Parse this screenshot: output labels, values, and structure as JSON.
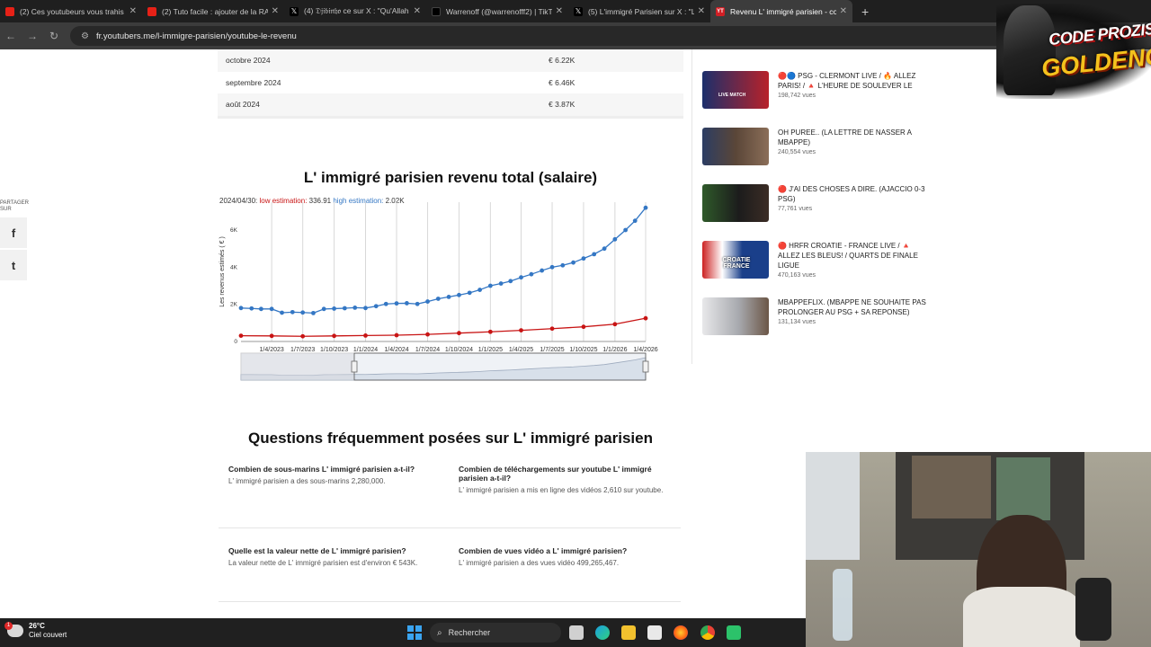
{
  "browser": {
    "tabs": [
      {
        "title": "(2) Ces youtubeurs vous trahis",
        "favicon": "youtube-icon"
      },
      {
        "title": "(2) Tuto facile : ajouter de la RA",
        "favicon": "youtube-icon"
      },
      {
        "title": "(4) 𝔇𝔧𝔦𝔟𝔦𝔫𝔥𝔬 ce sur X : \"Qu'Allah",
        "favicon": "x-icon"
      },
      {
        "title": "Warrenoff (@warrenofff2) | TikT",
        "favicon": "tiktok-icon"
      },
      {
        "title": "(5) L'immigré Parisien sur X : \"L",
        "favicon": "x-icon"
      },
      {
        "title": "Revenu L' immigré parisien - co",
        "favicon": "youtubers-icon",
        "active": true
      }
    ],
    "new_tab": "+",
    "url": "fr.youtubers.me/l-immigre-parisien/youtube-le-revenu"
  },
  "earnings_table": {
    "rows": [
      {
        "month": "octobre 2024",
        "value": "€ 6.22K"
      },
      {
        "month": "septembre 2024",
        "value": "€ 6.46K"
      },
      {
        "month": "août 2024",
        "value": "€ 3.87K"
      }
    ]
  },
  "share": {
    "label_line1": "PARTAGER",
    "label_line2": "SUR",
    "facebook": "f",
    "twitter": "t"
  },
  "chart": {
    "title": "L' immigré parisien revenu total (salaire)",
    "info_date": "2024/04/30:",
    "low_label": "low estimation:",
    "low_value": "336.91",
    "high_label": "high estimation:",
    "high_value": "2.02K"
  },
  "chart_data": {
    "type": "line",
    "title": "L' immigré parisien revenu total (salaire)",
    "xlabel": "",
    "ylabel": "Les revenus estimés ( € )",
    "ylim": [
      0,
      7500
    ],
    "y_ticks": [
      "0",
      "2K",
      "4K",
      "6K"
    ],
    "x_ticks": [
      "1/4/2023",
      "1/7/2023",
      "1/10/2023",
      "1/1/2024",
      "1/4/2024",
      "1/7/2024",
      "1/10/2024",
      "1/1/2025",
      "1/4/2025",
      "1/7/2025",
      "1/10/2025",
      "1/1/2026",
      "1/4/2026"
    ],
    "legend": "none",
    "grid": true,
    "series": [
      {
        "name": "high estimation",
        "color": "#3477c4",
        "x": [
          "2023-01-01",
          "2023-02-01",
          "2023-03-01",
          "2023-04-01",
          "2023-05-01",
          "2023-06-01",
          "2023-07-01",
          "2023-08-01",
          "2023-09-01",
          "2023-10-01",
          "2023-11-01",
          "2023-12-01",
          "2024-01-01",
          "2024-02-01",
          "2024-03-01",
          "2024-04-01",
          "2024-05-01",
          "2024-06-01",
          "2024-07-01",
          "2024-08-01",
          "2024-09-01",
          "2024-10-01",
          "2024-11-01",
          "2024-12-01",
          "2025-01-01",
          "2025-02-01",
          "2025-03-01",
          "2025-04-01",
          "2025-05-01",
          "2025-06-01",
          "2025-07-01",
          "2025-08-01",
          "2025-09-01",
          "2025-10-01",
          "2025-11-01",
          "2025-12-01",
          "2026-01-01",
          "2026-02-01",
          "2026-03-01",
          "2026-04-01"
        ],
        "values": [
          1800,
          1780,
          1750,
          1750,
          1550,
          1580,
          1560,
          1530,
          1750,
          1770,
          1790,
          1820,
          1800,
          1900,
          2020,
          2050,
          2060,
          2020,
          2150,
          2300,
          2400,
          2500,
          2620,
          2780,
          3000,
          3120,
          3250,
          3450,
          3620,
          3820,
          4000,
          4100,
          4250,
          4470,
          4700,
          5000,
          5500,
          6000,
          6500,
          7200
        ]
      },
      {
        "name": "low estimation",
        "color": "#c81414",
        "x": [
          "2023-01-01",
          "2023-04-01",
          "2023-07-01",
          "2023-10-01",
          "2024-01-01",
          "2024-04-01",
          "2024-07-01",
          "2024-10-01",
          "2025-01-01",
          "2025-04-01",
          "2025-07-01",
          "2025-10-01",
          "2026-01-01",
          "2026-04-01"
        ],
        "values": [
          310,
          300,
          280,
          300,
          320,
          337,
          380,
          450,
          520,
          600,
          690,
          790,
          930,
          1250
        ]
      }
    ],
    "navigator": true
  },
  "related_videos": [
    {
      "title": "🔴🔵 PSG - CLERMONT LIVE / 🔥 ALLEZ PARIS! / 🔺 L'HEURE DE SOULEVER LE",
      "views": "198,742 vues",
      "thumb_color": "#1c2f6b",
      "thumb_overlay": "LIVE MATCH"
    },
    {
      "title": "OH PUREE.. (LA LETTRE DE NASSER A MBAPPE)",
      "views": "240,554 vues",
      "thumb_color": "#2b2b2b",
      "thumb_overlay": ""
    },
    {
      "title": "🔴 J'AI DES CHOSES A DIRE. (AJACCIO 0-3 PSG)",
      "views": "77,761 vues",
      "thumb_color": "#2f5a2a",
      "thumb_overlay": ""
    },
    {
      "title": "🔴 HRFR CROATIE - FRANCE LIVE / 🔺 ALLEZ LES BLEUS! / QUARTS DE FINALE LIGUE",
      "views": "470,163 vues",
      "thumb_color": "#1a3f8a",
      "thumb_overlay": "CROATIE FRANCE"
    },
    {
      "title": "MBAPPEFLIX. (MBAPPE NE SOUHAITE PAS PROLONGER AU PSG + SA REPONSE)",
      "views": "131,134 vues",
      "thumb_color": "#bfbfbf",
      "thumb_overlay": ""
    }
  ],
  "faq": {
    "title": "Questions fréquemment posées sur L' immigré parisien",
    "items": [
      {
        "q": "Combien de sous-marins L' immigré parisien a-t-il?",
        "a": "L' immigré parisien a des sous-marins 2,280,000."
      },
      {
        "q": "Combien de téléchargements sur youtube L' immigré parisien a-t-il?",
        "a": "L' immigré parisien a mis en ligne des vidéos 2,610 sur youtube."
      },
      {
        "q": "Quelle est la valeur nette de L' immigré parisien?",
        "a": "La valeur nette de L' immigré parisien est d'environ € 543K."
      },
      {
        "q": "Combien de vues vidéo a L' immigré parisien?",
        "a": "L' immigré parisien a des vues vidéo 499,265,467."
      }
    ]
  },
  "overlay": {
    "logo_line1": "CODE PROZIS",
    "logo_line2": "GOLDENG"
  },
  "taskbar": {
    "temperature": "26°C",
    "weather": "Ciel couvert",
    "badge": "1",
    "search_placeholder": "Rechercher"
  }
}
